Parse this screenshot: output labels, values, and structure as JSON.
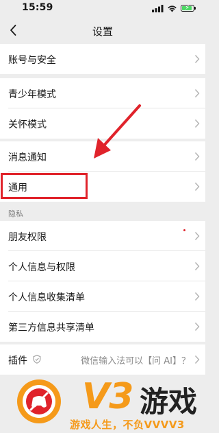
{
  "status_bar": {
    "time": "15:59",
    "icons": [
      "signal-icon",
      "wifi-icon",
      "battery-charging-icon"
    ]
  },
  "nav": {
    "title": "设置",
    "back_icon": "chevron-left-icon"
  },
  "groups": [
    {
      "items": [
        {
          "label": "账号与安全"
        }
      ]
    },
    {
      "items": [
        {
          "label": "青少年模式"
        },
        {
          "label": "关怀模式"
        }
      ]
    },
    {
      "items": [
        {
          "label": "消息通知"
        },
        {
          "label": "通用"
        }
      ]
    },
    {
      "header": "隐私",
      "items": [
        {
          "label": "朋友权限"
        },
        {
          "label": "个人信息与权限"
        },
        {
          "label": "个人信息收集清单"
        },
        {
          "label": "第三方信息共享清单"
        }
      ]
    },
    {
      "items": [
        {
          "label": "插件",
          "note": "微信输入法可以【问 AI】？",
          "icon": "shield-icon"
        }
      ]
    }
  ],
  "annotation": {
    "arrow_color": "#e0232b",
    "highlight_target": "通用"
  },
  "watermark": {
    "brand": "V3",
    "name": "游戏",
    "slogan": "游戏人生，不负VVVV3"
  },
  "colors": {
    "background": "#ededed",
    "row": "#ffffff",
    "accent_red": "#e0232b",
    "watermark_orange": "#f59a1a"
  }
}
